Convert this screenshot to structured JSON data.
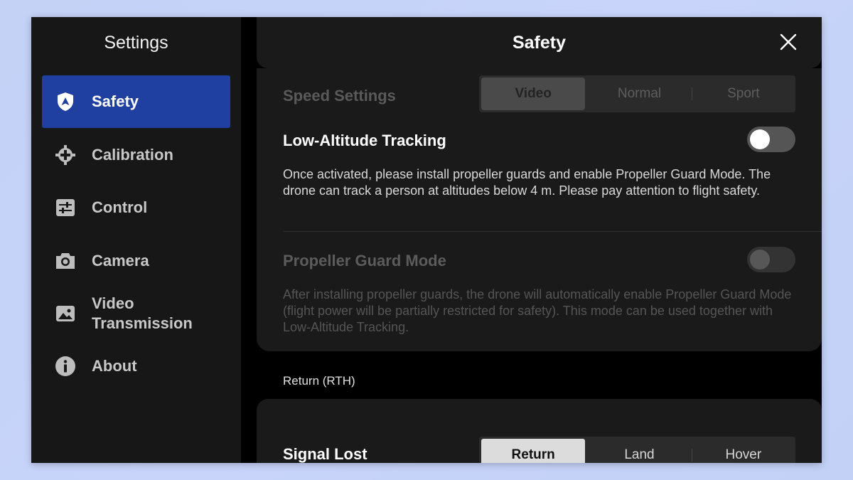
{
  "sidebar": {
    "title": "Settings",
    "items": [
      {
        "label": "Safety",
        "icon": "shield-icon",
        "active": true
      },
      {
        "label": "Calibration",
        "icon": "crosshair-icon",
        "active": false
      },
      {
        "label": "Control",
        "icon": "sliders-icon",
        "active": false
      },
      {
        "label": "Camera",
        "icon": "camera-icon",
        "active": false
      },
      {
        "label": "Video Transmission",
        "icon": "image-icon",
        "active": false
      },
      {
        "label": "About",
        "icon": "info-icon",
        "active": false
      }
    ]
  },
  "header": {
    "title": "Safety",
    "close_icon": "close-icon"
  },
  "speed_settings": {
    "label": "Speed Settings",
    "options": [
      "Video",
      "Normal",
      "Sport"
    ],
    "selected": "Video"
  },
  "low_altitude": {
    "label": "Low-Altitude Tracking",
    "enabled": false,
    "description": "Once activated, please install propeller guards and enable Propeller Guard Mode. The drone can track a person at altitudes below 4 m. Please pay attention to flight safety."
  },
  "propeller_guard": {
    "label": "Propeller Guard Mode",
    "enabled": false,
    "description": "After installing propeller guards, the drone will automatically enable Propeller Guard Mode (flight power will be partially restricted for safety). This mode can be used together with Low-Altitude Tracking."
  },
  "return_section": {
    "title": "Return (RTH)"
  },
  "signal_lost": {
    "label": "Signal Lost",
    "options": [
      "Return",
      "Land",
      "Hover"
    ],
    "selected": "Return"
  },
  "colors": {
    "accent": "#1f3fa1",
    "panel": "#1a1a1a",
    "sidebar": "#171717"
  }
}
